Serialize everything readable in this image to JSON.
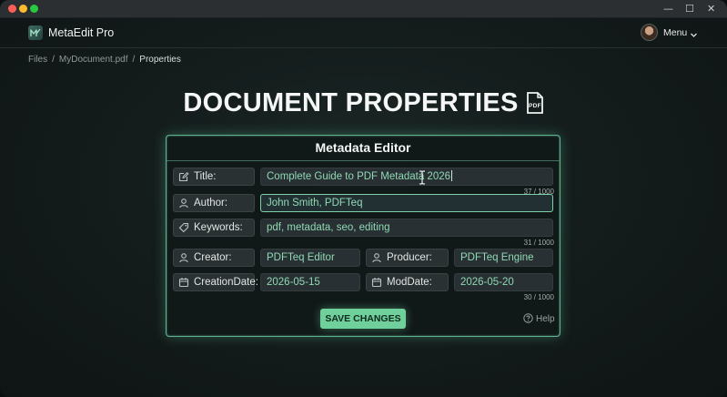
{
  "app": {
    "name": "MetaEdit Pro",
    "menu_label": "Menu"
  },
  "window_controls": {
    "minimize": "—",
    "maximize": "☐",
    "close": "✕"
  },
  "breadcrumb": {
    "items": [
      "Files",
      "MyDocument.pdf"
    ],
    "current": "Properties",
    "separator": "/"
  },
  "page": {
    "title": "DOCUMENT PROPERTIES"
  },
  "panel": {
    "title": "Metadata Editor",
    "fields": {
      "title": {
        "label": "Title:",
        "value": "Complete Guide to PDF Metadata 2026",
        "counter": "37 / 1000",
        "icon": "edit-icon"
      },
      "author": {
        "label": "Author:",
        "value": "John Smith, PDFTeq",
        "icon": "user-icon"
      },
      "keywords": {
        "label": "Keywords:",
        "value": "pdf, metadata, seo, editing",
        "counter": "31 / 1000",
        "icon": "tag-icon"
      },
      "creator": {
        "label": "Creator:",
        "value": "PDFTeq Editor",
        "icon": "user-icon"
      },
      "producer": {
        "label": "Producer:",
        "value": "PDFTeq Engine",
        "icon": "user-icon"
      },
      "creation_date": {
        "label": "CreationDate:",
        "value": "2026-05-15",
        "icon": "calendar-icon"
      },
      "mod_date": {
        "label": "ModDate:",
        "value": "2026-05-20",
        "counter": "30 / 1000",
        "icon": "calendar-icon"
      }
    },
    "save_label": "SAVE CHANGES",
    "help_label": "Help"
  },
  "colors": {
    "accent": "#6fd09b",
    "value_text": "#8fd9b4",
    "panel_border": "#5fb191"
  }
}
